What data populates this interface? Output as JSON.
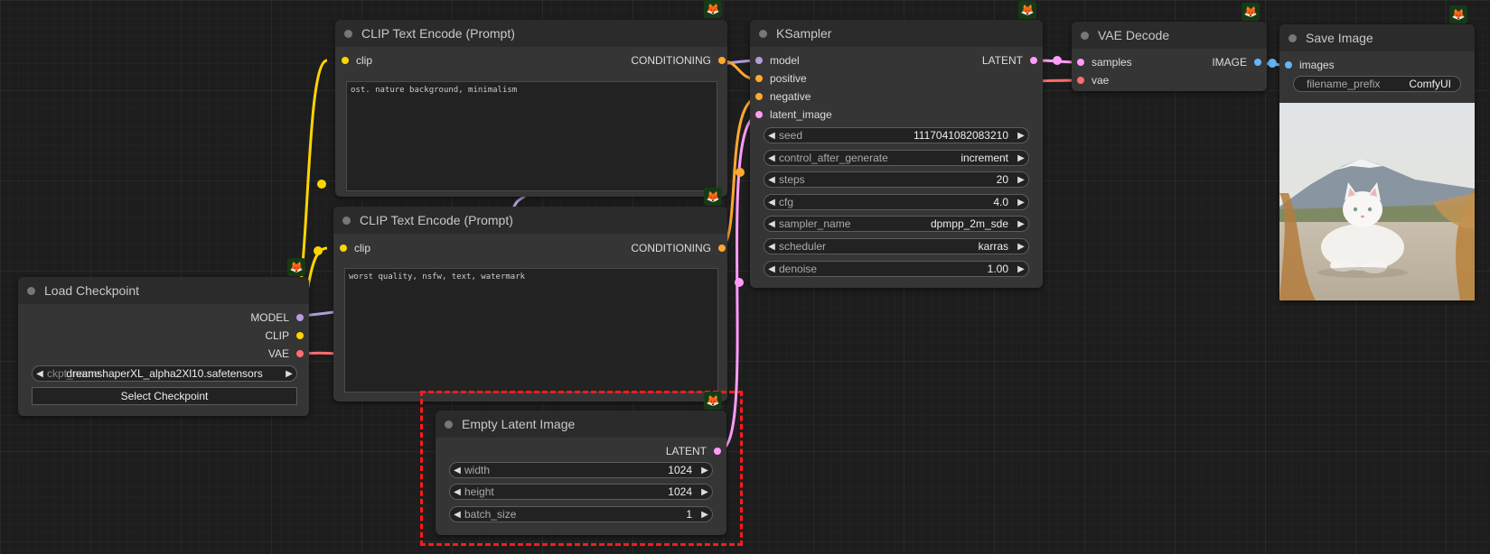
{
  "nodes": {
    "clip_pos": {
      "title": "CLIP Text Encode (Prompt)",
      "input_clip": "clip",
      "output": "CONDITIONING",
      "text": "ost. nature background, minimalism"
    },
    "clip_neg": {
      "title": "CLIP Text Encode (Prompt)",
      "input_clip": "clip",
      "output": "CONDITIONING",
      "text": "worst quality, nsfw, text, watermark"
    },
    "ksampler": {
      "title": "KSampler",
      "inputs": [
        "model",
        "positive",
        "negative",
        "latent_image"
      ],
      "output": "LATENT",
      "widgets": [
        {
          "label": "seed",
          "value": "1117041082083210"
        },
        {
          "label": "control_after_generate",
          "value": "increment"
        },
        {
          "label": "steps",
          "value": "20"
        },
        {
          "label": "cfg",
          "value": "4.0"
        },
        {
          "label": "sampler_name",
          "value": "dpmpp_2m_sde"
        },
        {
          "label": "scheduler",
          "value": "karras"
        },
        {
          "label": "denoise",
          "value": "1.00"
        }
      ]
    },
    "vae_decode": {
      "title": "VAE Decode",
      "inputs": [
        "samples",
        "vae"
      ],
      "output": "IMAGE"
    },
    "save_image": {
      "title": "Save Image",
      "input": "images",
      "prefix_label": "filename_prefix",
      "prefix_value": "ComfyUI"
    },
    "load_checkpoint": {
      "title": "Load Checkpoint",
      "outputs": [
        "MODEL",
        "CLIP",
        "VAE"
      ],
      "ckpt_label": "ckpt_name",
      "ckpt_value": "dreamshaperXL_alpha2Xl10.safetensors",
      "button": "Select Checkpoint"
    },
    "empty_latent": {
      "title": "Empty Latent Image",
      "output": "LATENT",
      "widgets": [
        {
          "label": "width",
          "value": "1024"
        },
        {
          "label": "height",
          "value": "1024"
        },
        {
          "label": "batch_size",
          "value": "1"
        }
      ]
    }
  },
  "glyphs": {
    "left": "◀",
    "right": "▶",
    "fox": "🦊"
  },
  "colors": {
    "model": "#b39ddb",
    "clip": "#ffd500",
    "vae": "#ff6e6e",
    "conditioning": "#ffa931",
    "latent": "#ff9cf9",
    "image": "#64b5f6",
    "highlight": "#ff1a1a"
  },
  "icons": [
    "comfy-fox-icon"
  ]
}
